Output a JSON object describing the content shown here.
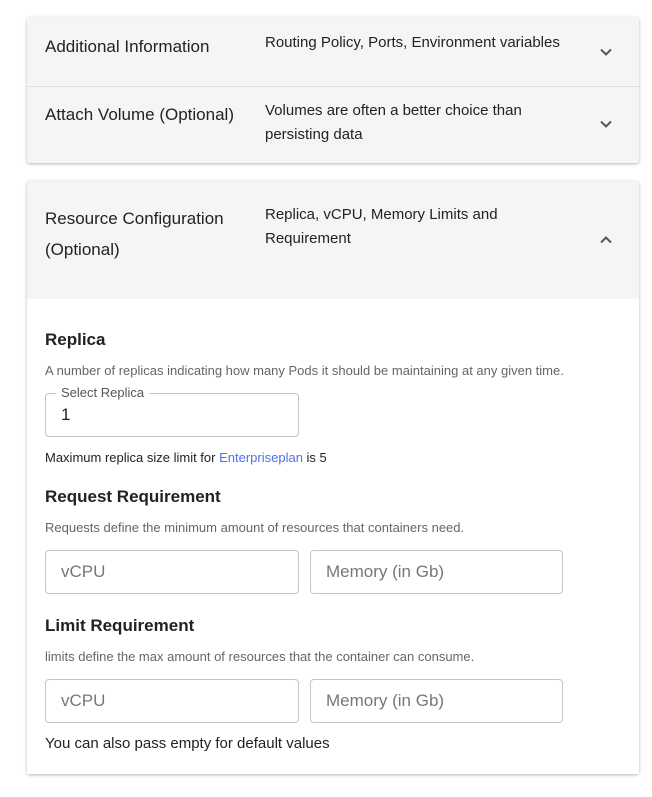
{
  "accordions": [
    {
      "title": "Additional Information",
      "description": "Routing Policy, Ports, Environment variables",
      "expanded": false
    },
    {
      "title": "Attach Volume (Optional)",
      "description": "Volumes are often a better choice than persisting data",
      "expanded": false
    },
    {
      "title": "Resource Configuration (Optional)",
      "description": "Replica, vCPU, Memory Limits and Requirement",
      "expanded": true
    }
  ],
  "replica": {
    "heading": "Replica",
    "description": "A number of replicas indicating how many Pods it should be maintaining at any given time.",
    "field_label": "Select Replica",
    "value": "1",
    "note_prefix": "Maximum replica size limit for ",
    "note_link": "Enterpriseplan",
    "note_suffix": " is 5"
  },
  "request": {
    "heading": "Request Requirement",
    "description": "Requests define the minimum amount of resources that containers need.",
    "vcpu_placeholder": "vCPU",
    "memory_placeholder": "Memory (in Gb)"
  },
  "limit": {
    "heading": "Limit Requirement",
    "description": "limits define the max amount of resources that the container can consume.",
    "vcpu_placeholder": "vCPU",
    "memory_placeholder": "Memory (in Gb)"
  },
  "footer_note": "You can also pass empty for default values"
}
